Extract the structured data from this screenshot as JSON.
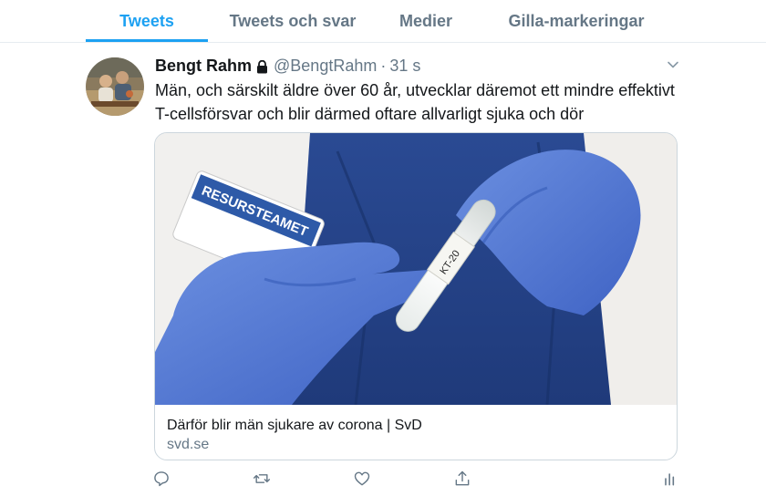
{
  "tabs": [
    {
      "label": "Tweets",
      "active": true
    },
    {
      "label": "Tweets och svar",
      "active": false
    },
    {
      "label": "Medier",
      "active": false
    },
    {
      "label": "Gilla-markeringar",
      "active": false
    }
  ],
  "tweet": {
    "author_name": "Bengt Rahm",
    "handle": "@BengtRahm",
    "separator": "·",
    "time": "31 s",
    "lock_icon": "lock-icon",
    "text": "Män, och särskilt äldre över 60 år, utvecklar däremot ett mindre effektivt T-cellsförsvar och blir därmed oftare allvarligt sjuka och dör",
    "card": {
      "image_badge_text": "RESURSTEAMET",
      "tube_label": "KT-20",
      "title": "Därför blir män sjukare av corona | SvD",
      "domain": "svd.se"
    },
    "actions": [
      "reply-icon",
      "retweet-icon",
      "like-icon",
      "share-icon",
      "analytics-icon"
    ]
  },
  "colors": {
    "accent": "#1da1f2",
    "secondary_text": "#657786",
    "border": "#e6ecf0"
  }
}
